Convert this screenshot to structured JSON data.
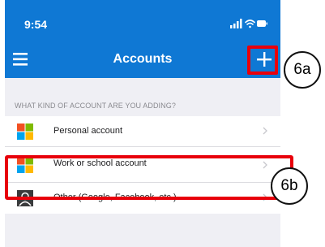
{
  "status_bar": {
    "time": "9:54",
    "icons": [
      "signal-icon",
      "wifi-icon",
      "battery-icon"
    ]
  },
  "nav": {
    "title": "Accounts",
    "menu_icon": "hamburger-menu-icon",
    "add_icon": "plus-icon"
  },
  "section_header": "WHAT KIND OF ACCOUNT ARE YOU ADDING?",
  "accounts": [
    {
      "label": "Personal account",
      "icon": "microsoft-logo-icon"
    },
    {
      "label": "Work or school account",
      "icon": "microsoft-logo-icon"
    },
    {
      "label": "Other (Google, Facebook, etc.)",
      "icon": "person-icon"
    }
  ],
  "annotations": {
    "add_callout": "6a",
    "work_callout": "6b"
  },
  "colors": {
    "header_blue": "#0f78d4",
    "highlight_red": "#e8000b",
    "background_gray": "#efeff4",
    "ms_red": "#f25022",
    "ms_green": "#7fba00",
    "ms_blue": "#00a4ef",
    "ms_yellow": "#ffb900"
  }
}
